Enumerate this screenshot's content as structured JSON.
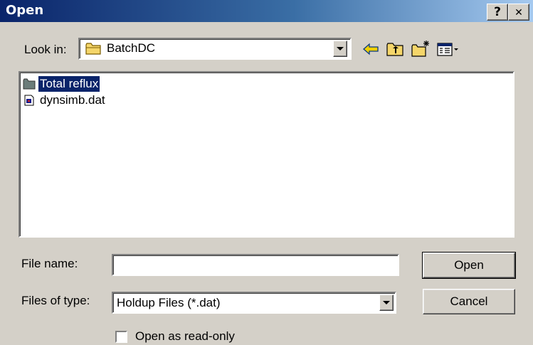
{
  "window": {
    "title": "Open",
    "help_label": "?",
    "close_label": "✕"
  },
  "lookin": {
    "label": "Look in:",
    "value": "BatchDC",
    "toolbar_icons": [
      "back-arrow-icon",
      "up-folder-icon",
      "new-folder-icon",
      "view-menu-icon"
    ]
  },
  "files": [
    {
      "name": "Total reflux",
      "type": "folder",
      "selected": true
    },
    {
      "name": "dynsimb.dat",
      "type": "file",
      "selected": false
    }
  ],
  "filename": {
    "label": "File name:",
    "value": ""
  },
  "filetype": {
    "label": "Files of type:",
    "value": "Holdup Files (*.dat)"
  },
  "buttons": {
    "open": "Open",
    "cancel": "Cancel"
  },
  "readonly": {
    "label": "Open as read-only",
    "checked": false
  },
  "colors": {
    "title_start": "#0a246a",
    "title_end": "#a6caf0",
    "selection": "#0a246a",
    "face": "#d4d0c8"
  }
}
